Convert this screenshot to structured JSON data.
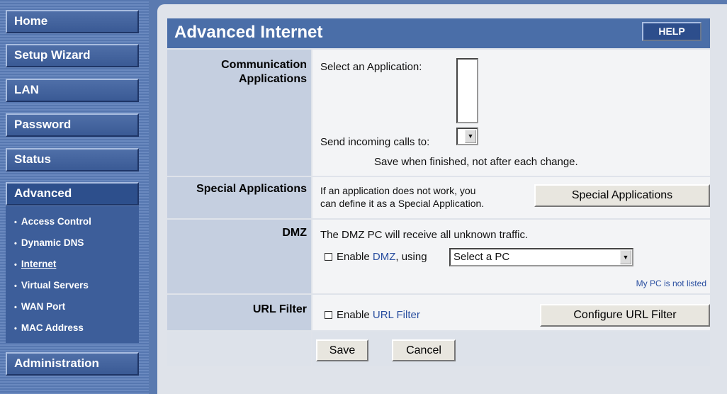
{
  "sidebar": {
    "items": [
      {
        "label": "Home"
      },
      {
        "label": "Setup Wizard"
      },
      {
        "label": "LAN"
      },
      {
        "label": "Password"
      },
      {
        "label": "Status"
      },
      {
        "label": "Advanced"
      },
      {
        "label": "Administration"
      }
    ],
    "submenu": [
      {
        "label": "Access Control"
      },
      {
        "label": "Dynamic DNS"
      },
      {
        "label": "Internet"
      },
      {
        "label": "Virtual Servers"
      },
      {
        "label": "WAN Port"
      },
      {
        "label": "MAC Address"
      }
    ]
  },
  "header": {
    "title": "Advanced Internet",
    "help_label": "HELP"
  },
  "comm": {
    "label_line1": "Communication",
    "label_line2": "Applications",
    "select_app_label": "Select an Application:",
    "send_calls_label": "Send incoming calls to:",
    "save_note": "Save when finished, not after each change."
  },
  "special": {
    "label": "Special Applications",
    "desc_line1": "If an application does not work, you",
    "desc_line2": "can define it as a Special Application.",
    "button_label": "Special Applications"
  },
  "dmz": {
    "label": "DMZ",
    "desc": "The DMZ PC will receive all unknown traffic.",
    "enable_prefix": "Enable ",
    "enable_link": "DMZ",
    "enable_suffix": ", using",
    "select_value": "Select a PC",
    "not_listed_link": "My PC is not listed"
  },
  "url": {
    "label": "URL Filter",
    "enable_prefix": "Enable ",
    "enable_link": "URL Filter",
    "button_label": "Configure URL Filter"
  },
  "actions": {
    "save_label": "Save",
    "cancel_label": "Cancel"
  }
}
